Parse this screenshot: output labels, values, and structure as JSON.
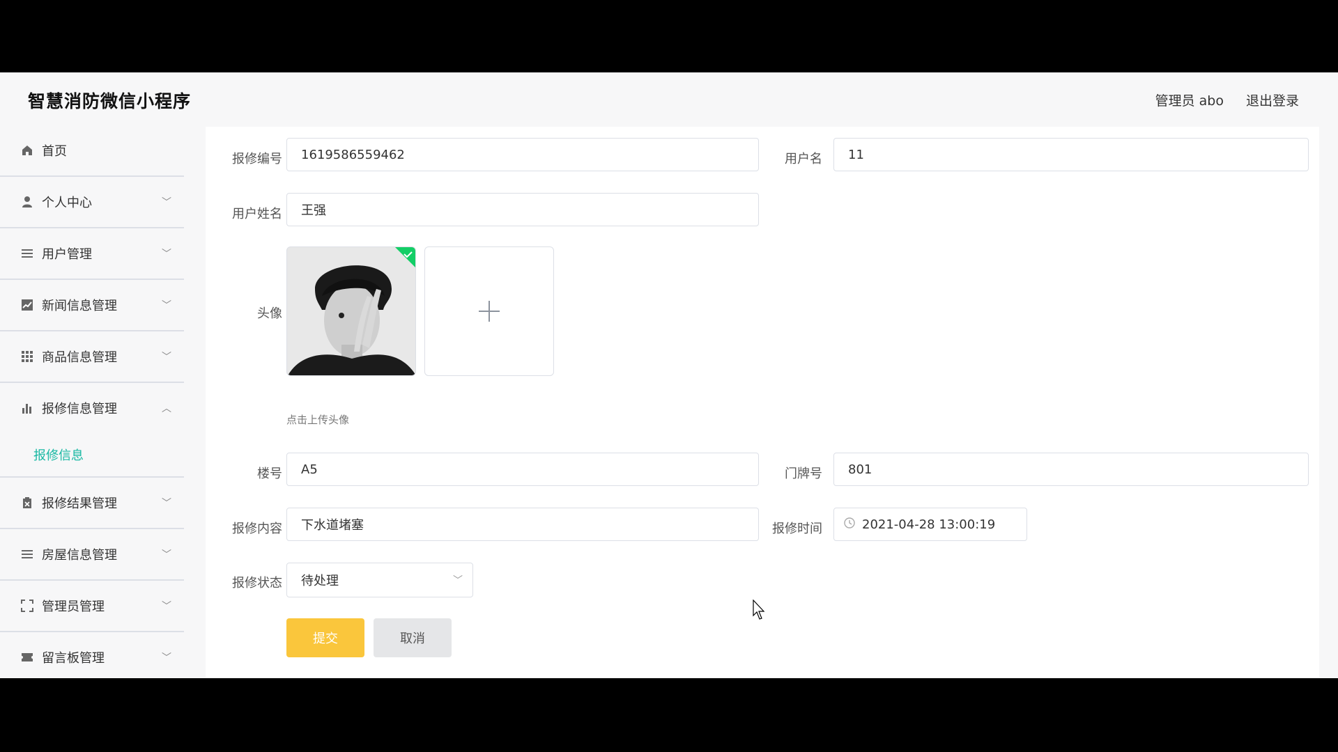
{
  "header": {
    "title": "智慧消防微信小程序",
    "user_label": "管理员 abo",
    "logout_label": "退出登录"
  },
  "sidebar": {
    "items": [
      {
        "label": "首页",
        "icon": "home-icon"
      },
      {
        "label": "个人中心",
        "icon": "user-icon"
      },
      {
        "label": "用户管理",
        "icon": "list-icon"
      },
      {
        "label": "新闻信息管理",
        "icon": "chart-icon"
      },
      {
        "label": "商品信息管理",
        "icon": "grid-icon"
      },
      {
        "label": "报修信息管理",
        "icon": "bar-chart-icon",
        "expanded": true,
        "children": [
          "报修信息"
        ]
      },
      {
        "label": "报修结果管理",
        "icon": "clipboard-icon"
      },
      {
        "label": "房屋信息管理",
        "icon": "list-icon"
      },
      {
        "label": "管理员管理",
        "icon": "fullscreen-icon"
      },
      {
        "label": "留言板管理",
        "icon": "ticket-icon"
      }
    ],
    "active_color": "#19b8a3"
  },
  "form": {
    "repair_no_label": "报修编号",
    "repair_no": "1619586559462",
    "username_label": "用户名",
    "username": "11",
    "realname_label": "用户姓名",
    "realname": "王强",
    "avatar_label": "头像",
    "avatar_hint": "点击上传头像",
    "building_label": "楼号",
    "building": "A5",
    "door_label": "门牌号",
    "door": "801",
    "content_label": "报修内容",
    "content": "下水道堵塞",
    "time_label": "报修时间",
    "time": "2021-04-28 13:00:19",
    "status_label": "报修状态",
    "status": "待处理",
    "submit_label": "提交",
    "cancel_label": "取消"
  },
  "colors": {
    "submit_bg": "#fac63c",
    "cancel_bg": "#e5e6e8",
    "upload_success": "#13ce66"
  }
}
